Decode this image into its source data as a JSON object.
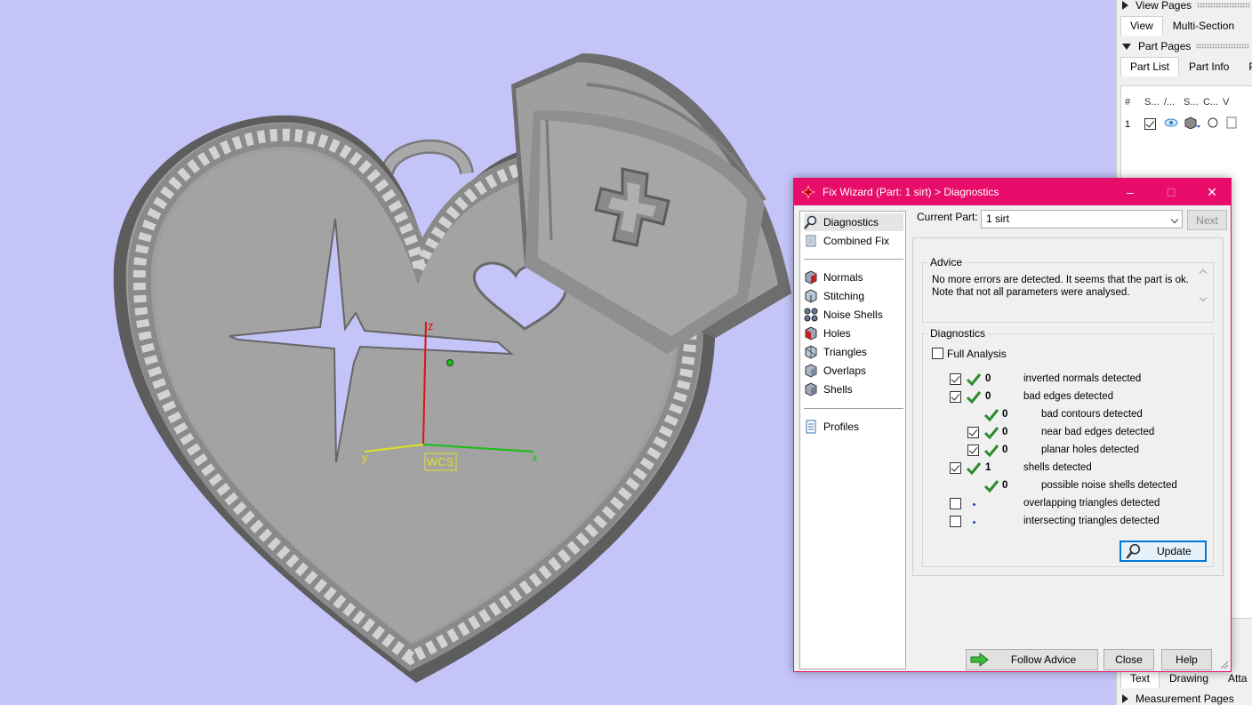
{
  "viewport": {
    "axis_z": "z",
    "axis_y": "y",
    "axis_x": "x",
    "wcs_label": "WCS"
  },
  "right_panel": {
    "view_pages": "View Pages",
    "view_tabs": [
      "View",
      "Multi-Section"
    ],
    "part_pages": "Part Pages",
    "part_tabs": [
      "Part List",
      "Part Info",
      "Pa"
    ],
    "columns": [
      "#",
      "S...",
      "/...",
      "S...",
      "C...",
      "V"
    ],
    "row_index": "1",
    "bottom_tabs": [
      "Text",
      "Drawing",
      "Atta"
    ],
    "measurement_pages": "Measurement Pages"
  },
  "dialog": {
    "title": "Fix Wizard (Part: 1 sirt) > Diagnostics",
    "accent_color": "#e80d6b",
    "nav": {
      "diagnostics": "Diagnostics",
      "combined_fix": "Combined Fix",
      "normals": "Normals",
      "stitching": "Stitching",
      "noise_shells": "Noise Shells",
      "holes": "Holes",
      "triangles": "Triangles",
      "overlaps": "Overlaps",
      "shells": "Shells",
      "profiles": "Profiles"
    },
    "current_part_label": "Current Part:",
    "current_part_value": "1 sirt",
    "next_label": "Next",
    "advice_title": "Advice",
    "advice_text": "No more errors are detected. It seems that the part is ok. Note that not all parameters were analysed.",
    "diagnostics_title": "Diagnostics",
    "full_analysis_label": "Full Analysis",
    "rows": {
      "inverted_normals": {
        "count": "0",
        "label": "inverted normals detected"
      },
      "bad_edges": {
        "count": "0",
        "label": "bad edges detected"
      },
      "bad_contours": {
        "count": "0",
        "label": "bad contours detected"
      },
      "near_bad_edges": {
        "count": "0",
        "label": "near bad edges detected"
      },
      "planar_holes": {
        "count": "0",
        "label": "planar holes detected"
      },
      "shells": {
        "count": "1",
        "label": "shells detected"
      },
      "noise_shells": {
        "count": "0",
        "label": "possible noise shells detected"
      },
      "overlapping": {
        "label": "overlapping triangles detected"
      },
      "intersecting": {
        "label": "intersecting triangles detected"
      }
    },
    "update_label": "Update",
    "follow_advice_label": "Follow Advice",
    "close_label": "Close",
    "help_label": "Help"
  }
}
